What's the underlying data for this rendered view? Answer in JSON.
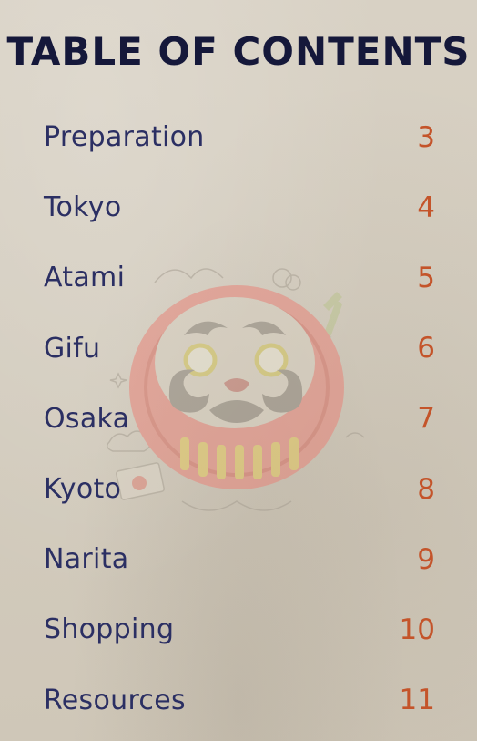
{
  "page": {
    "title": "TABLE OF CONTENTS"
  },
  "toc": {
    "items": [
      {
        "label": "Preparation",
        "page": "3"
      },
      {
        "label": "Tokyo",
        "page": "4"
      },
      {
        "label": "Atami",
        "page": "5"
      },
      {
        "label": "Gifu",
        "page": "6"
      },
      {
        "label": "Osaka",
        "page": "7"
      },
      {
        "label": "Kyoto",
        "page": "8"
      },
      {
        "label": "Narita",
        "page": "9"
      },
      {
        "label": "Shopping",
        "page": "10"
      },
      {
        "label": "Resources",
        "page": "11"
      }
    ]
  },
  "colors": {
    "title": "#15183a",
    "label": "#2b2f63",
    "page_number": "#c4542a",
    "background": "#d6cfc2"
  },
  "icons": {
    "watermark": "daruma-doll-icon"
  }
}
